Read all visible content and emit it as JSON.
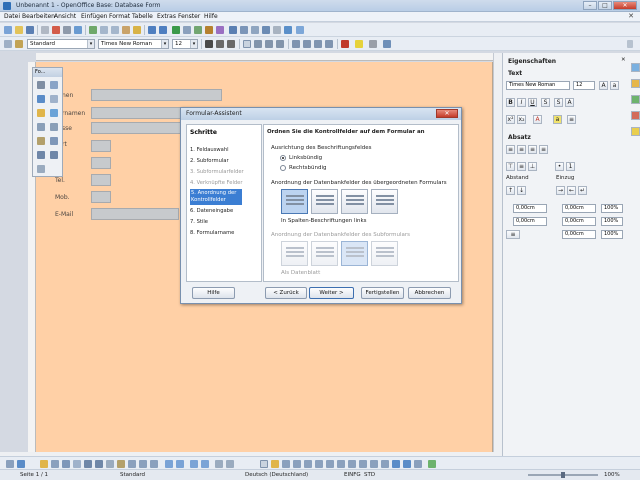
{
  "window": {
    "title": "Unbenannt 1 - OpenOffice Base: Database Form",
    "min": "–",
    "max": "□",
    "close": "✕"
  },
  "menubar": {
    "items": [
      "Datei",
      "Bearbeiten",
      "Ansicht",
      "Einfügen",
      "Format",
      "Tabelle",
      "Extras",
      "Fenster",
      "Hilfe"
    ],
    "close": "✕"
  },
  "toolbar": {
    "style": "Standard",
    "font": "Times New Roman",
    "size": "12"
  },
  "form": {
    "labels": [
      "nen",
      "rnamen",
      "sse",
      "rt",
      "Tel.",
      "Mob.",
      "E-Mail"
    ]
  },
  "palette": {
    "title": "Fo..."
  },
  "sidebar": {
    "title": "Eigenschaften",
    "text_section": "Text",
    "font": "Times New Roman",
    "size": "12",
    "para_section": "Absatz",
    "spacing_label": "Abstand",
    "indent_label": "Einzug",
    "value_zero": "0,00cm",
    "percent": "100%"
  },
  "dialog": {
    "title": "Formular-Assistent",
    "close": "✕",
    "steps_header": "Schritte",
    "steps": [
      "1. Feldauswahl",
      "2. Subformular",
      "3. Subformularfelder",
      "4. Verknüpfte Felder",
      "5. Anordnung der Kontrollfelder",
      "6. Dateneingabe",
      "7. Stile",
      "8. Formularname"
    ],
    "heading": "Ordnen Sie die Kontrollfelder auf dem Formular an",
    "label_alignment": "Ausrichtung des Beschriftungsfeldes",
    "align_left": "Linksbündig",
    "align_right": "Rechtsbündig",
    "main_arrangement": "Anordnung der Datenbankfelder des übergeordneten Formulars",
    "selected_layout": "In Spalten-Beschriftungen links",
    "sub_arrangement": "Anordnung der Datenbankfelder des Subformulars",
    "sub_selected": "Als Datenblatt",
    "buttons": {
      "help": "Hilfe",
      "back": "< Zurück",
      "next": "Weiter >",
      "finish": "Fertigstellen",
      "cancel": "Abbrechen"
    }
  },
  "status": {
    "page": "Seite 1 / 1",
    "style": "Standard",
    "language": "Deutsch (Deutschland)",
    "mode": "EINFG",
    "sel": "STD",
    "zoom": "100%"
  }
}
